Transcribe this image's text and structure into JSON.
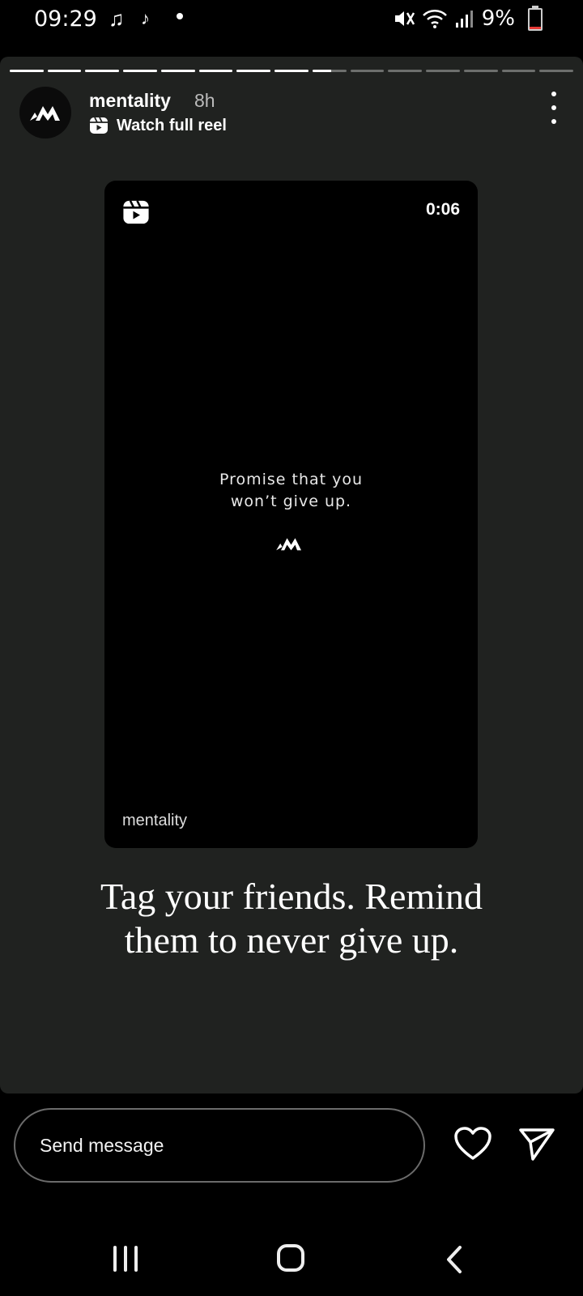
{
  "status_bar": {
    "time": "09:29",
    "battery_text": "9%",
    "battery_level": 0.09,
    "icons": [
      "music-note-icon",
      "music-note-icon",
      "notification-dot-icon",
      "mute-icon",
      "wifi-icon",
      "signal-icon",
      "battery-icon"
    ]
  },
  "story": {
    "progress": {
      "segments": 15,
      "current": 9,
      "current_fill": 0.55
    },
    "username": "mentality",
    "posted_ago": "8h",
    "watch_reel_label": "Watch full reel"
  },
  "reel": {
    "duration": "0:06",
    "text_line1": "Promise that you",
    "text_line2": "won’t give up.",
    "brand": "mentality"
  },
  "caption": {
    "line1": "Tag your friends. Remind",
    "line2": "them to never give up."
  },
  "bottom_bar": {
    "message_placeholder": "Send message"
  },
  "colors": {
    "story_background": "#202220",
    "page_background": "#000000",
    "battery_low": "#e53935"
  }
}
